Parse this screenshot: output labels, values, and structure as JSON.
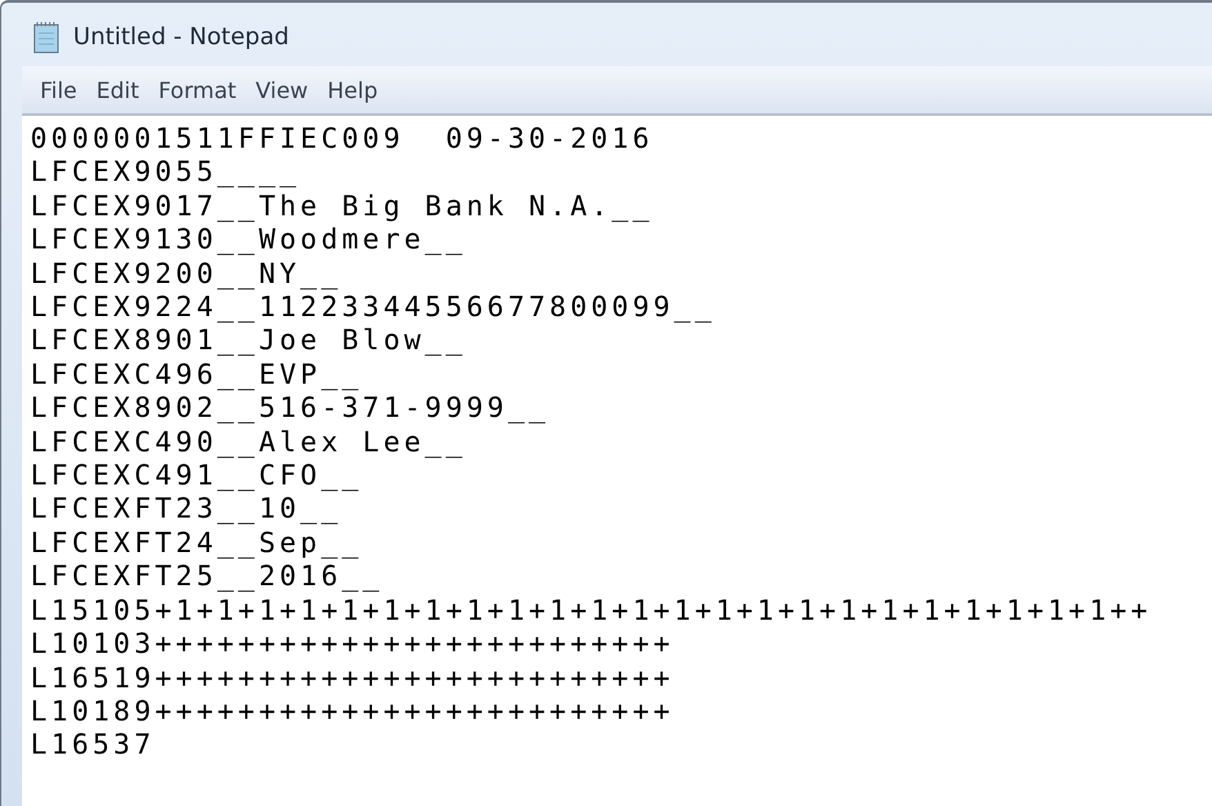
{
  "window": {
    "title": "Untitled - Notepad"
  },
  "menu": [
    "File",
    "Edit",
    "Format",
    "View",
    "Help"
  ],
  "lines": [
    "0000001511FFIEC009  09-30-2016",
    "LFCEX9055____",
    "LFCEX9017__The Big Bank N.A.__",
    "LFCEX9130__Woodmere__",
    "LFCEX9200__NY__",
    "LFCEX9224__11223344556677800099__",
    "LFCEX8901__Joe Blow__",
    "LFCEXC496__EVP__",
    "LFCEX8902__516-371-9999__",
    "LFCEXC490__Alex Lee__",
    "LFCEXC491__CFO__",
    "LFCEXFT23__10__",
    "LFCEXFT24__Sep__",
    "LFCEXFT25__2016__",
    "L15105+1+1+1+1+1+1+1+1+1+1+1+1+1+1+1+1+1+1+1+1+1+1+1++",
    "L10103+++++++++++++++++++++++++",
    "L16519+++++++++++++++++++++++++",
    "L10189+++++++++++++++++++++++++",
    "L16537"
  ]
}
